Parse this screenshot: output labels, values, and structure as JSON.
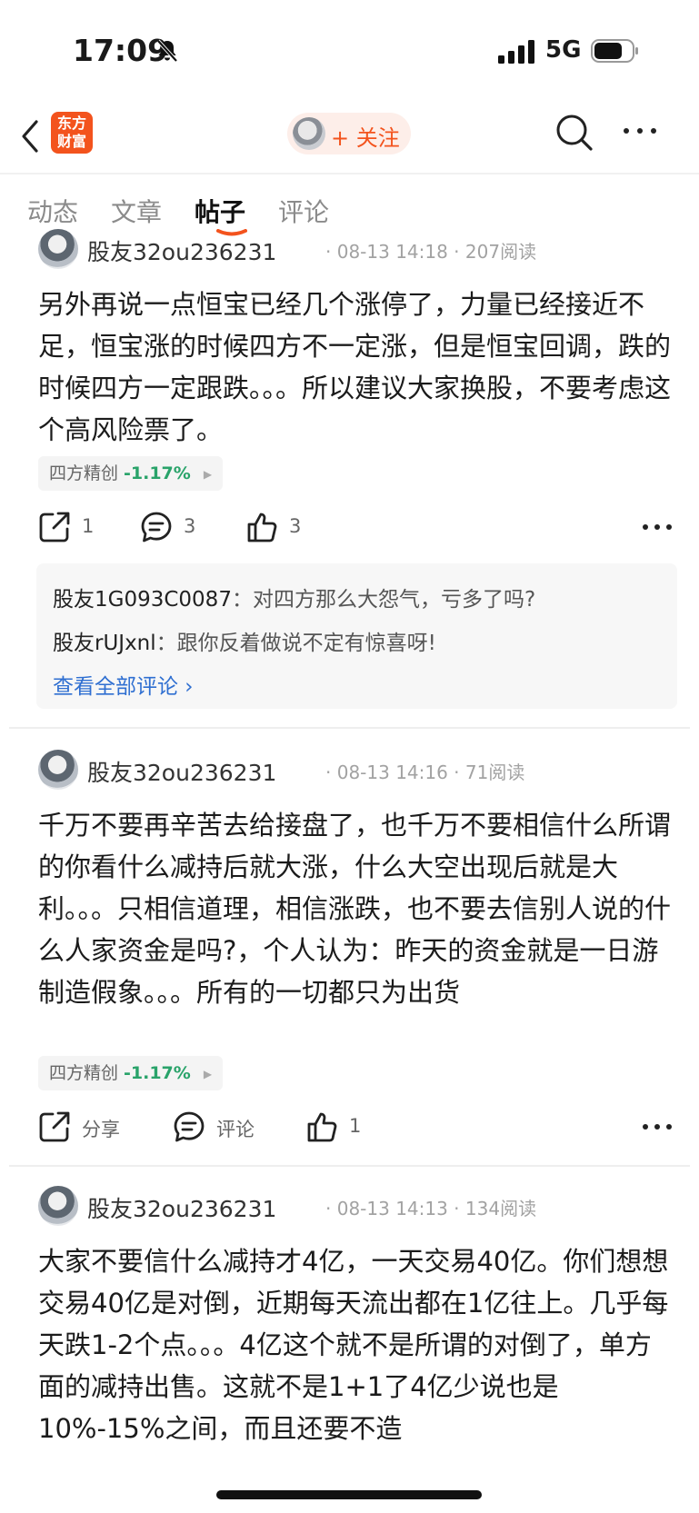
{
  "status_bar": {
    "time": "17:09",
    "network": "5G"
  },
  "nav": {
    "logo_text": "东方财富",
    "follow_label": "+ 关注"
  },
  "tabs": [
    {
      "label": "动态",
      "active": false
    },
    {
      "label": "文章",
      "active": false
    },
    {
      "label": "帖子",
      "active": true
    },
    {
      "label": "评论",
      "active": false
    }
  ],
  "posts": [
    {
      "author": "股友32ou236231",
      "meta": "· 08-13 14:18 · 207阅读",
      "text": "另外再说一点恒宝已经几个涨停了，力量已经接近不足，恒宝涨的时候四方不一定涨，但是恒宝回调，跌的时候四方一定跟跌。。。所以建议大家换股，不要考虑这个高风险票了。",
      "stock_name": "四方精创",
      "stock_change": "-1.17%",
      "share": "1",
      "comment": "3",
      "like": "3",
      "comments": [
        {
          "user": "股友1G093C0087",
          "sep": "：",
          "text": "对四方那么大怨气，亏多了吗?"
        },
        {
          "user": "股友rUJxnl",
          "sep": "：",
          "text": "跟你反着做说不定有惊喜呀!"
        }
      ],
      "see_all": "查看全部评论 ›"
    },
    {
      "author": "股友32ou236231",
      "meta": "· 08-13 14:16 · 71阅读",
      "text": "千万不要再辛苦去给接盘了，也千万不要相信什么所谓的你看什么减持后就大涨，什么大空出现后就是大利。。。只相信道理，相信涨跌，也不要去信别人说的什么人家资金是吗?，个人认为：昨天的资金就是一日游制造假象。。。所有的一切都只为出货",
      "stock_name": "四方精创",
      "stock_change": "-1.17%",
      "share": "分享",
      "comment": "评论",
      "like": "1"
    },
    {
      "author": "股友32ou236231",
      "meta": "· 08-13 14:13 · 134阅读",
      "text": "大家不要信什么减持才4亿，一天交易40亿。你们想想交易40亿是对倒，近期每天流出都在1亿往上。几乎每天跌1-2个点。。。4亿这个就不是所谓的对倒了，单方面的减持出售。这就不是1+1了4亿少说也是10%-15%之间，而且还要不造"
    }
  ],
  "colors": {
    "accent": "#f3531d",
    "down_green": "#29a36a",
    "link_blue": "#2f6fd1"
  }
}
